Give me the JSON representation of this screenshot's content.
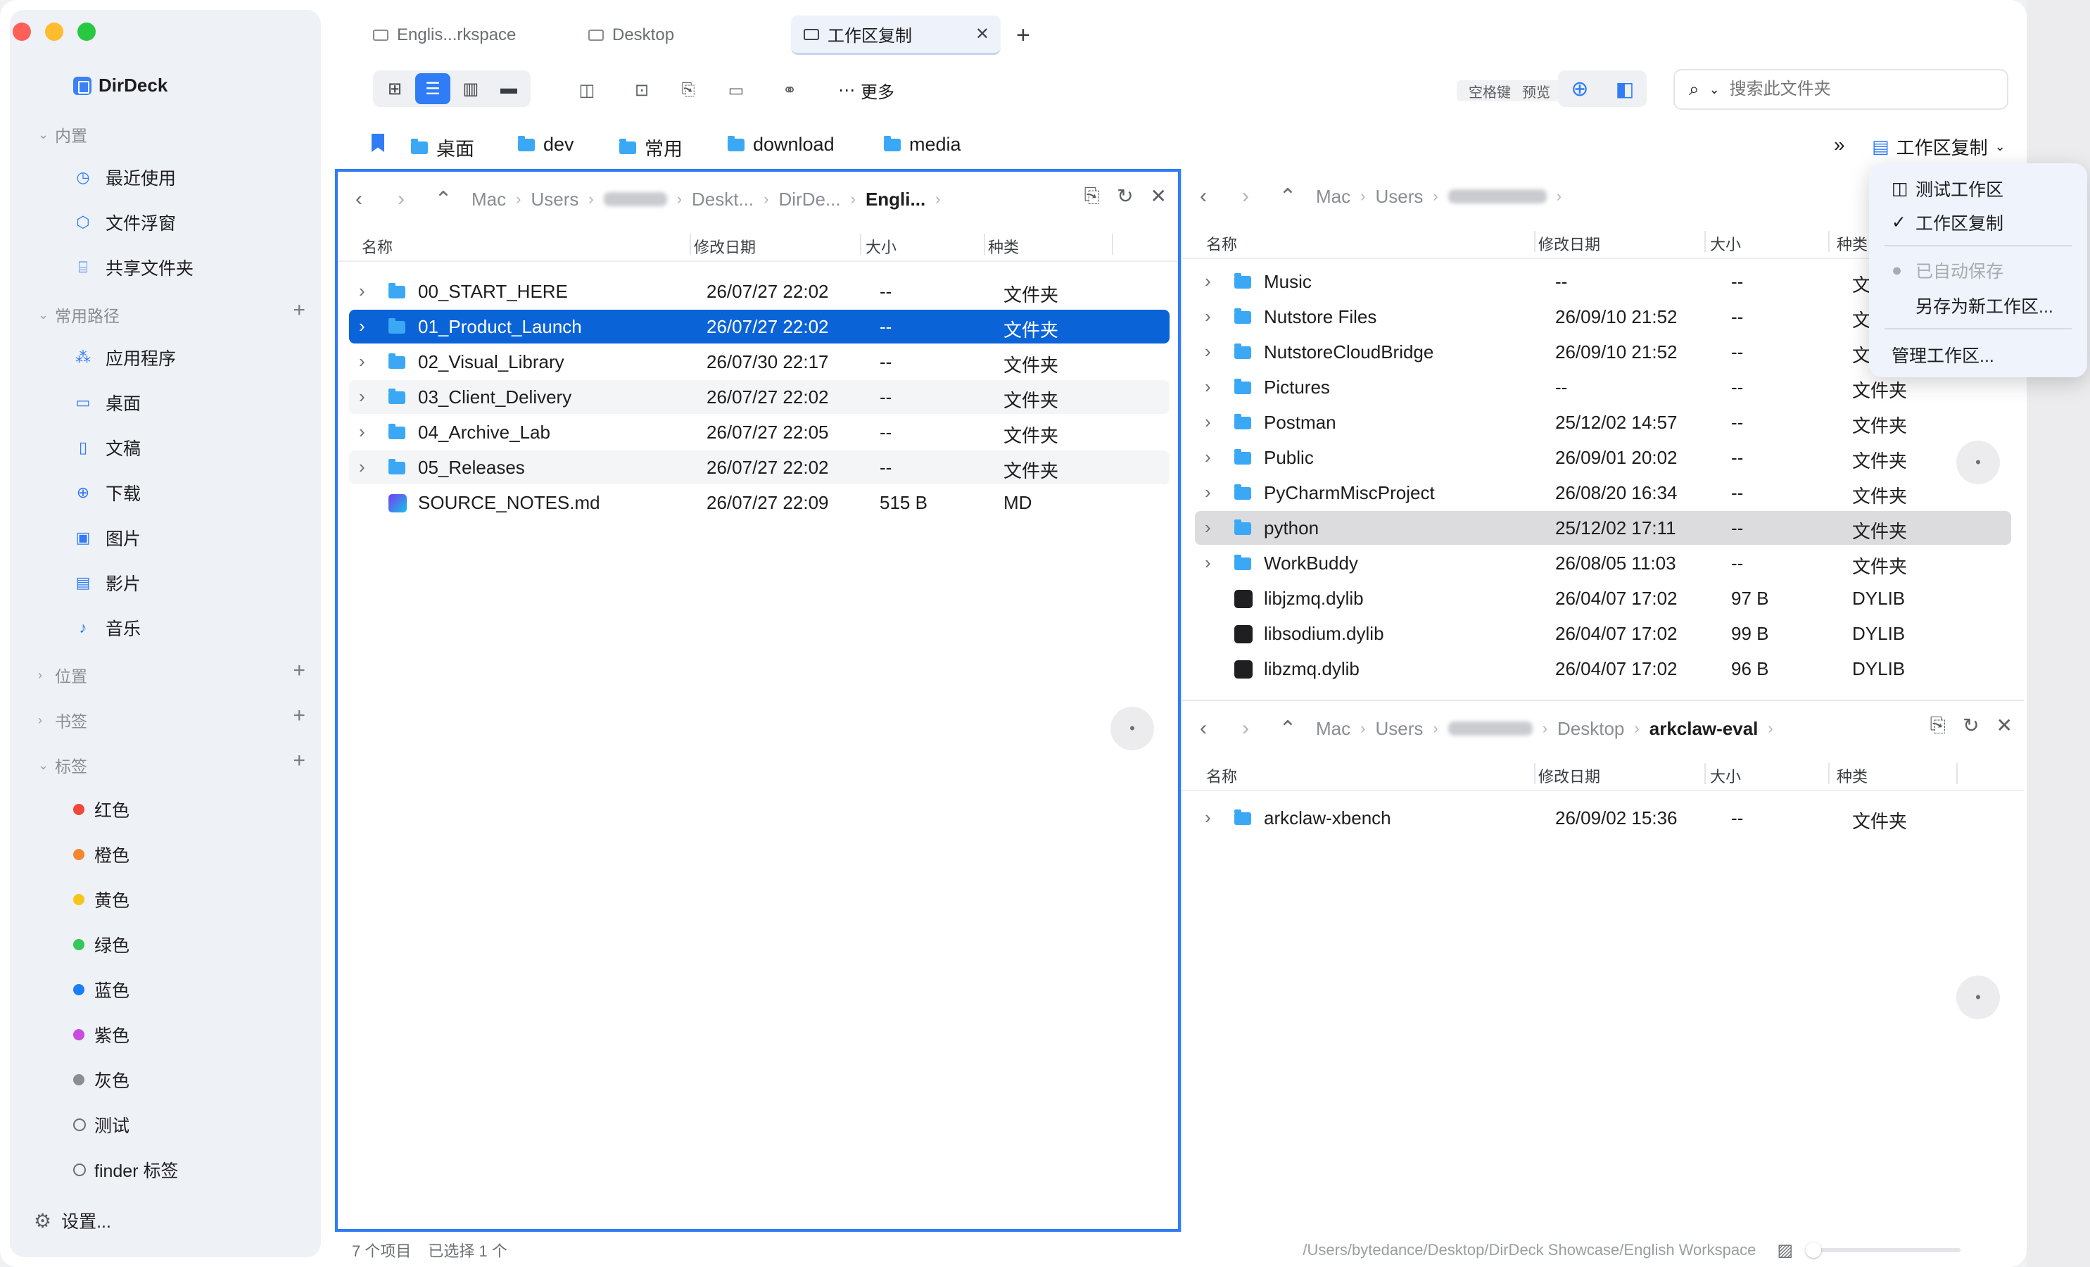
{
  "app": {
    "name": "DirDeck"
  },
  "sidebar": {
    "sections": {
      "builtin": "内置",
      "common": "常用路径",
      "locations": "位置",
      "bookmarks": "书签",
      "tags": "标签"
    },
    "builtin_items": [
      "最近使用",
      "文件浮窗",
      "共享文件夹"
    ],
    "common_items": [
      "应用程序",
      "桌面",
      "文稿",
      "下载",
      "图片",
      "影片",
      "音乐"
    ],
    "tags": [
      {
        "label": "红色",
        "color": "#f0473b"
      },
      {
        "label": "橙色",
        "color": "#f5862d"
      },
      {
        "label": "黄色",
        "color": "#f5c518"
      },
      {
        "label": "绿色",
        "color": "#34c759"
      },
      {
        "label": "蓝色",
        "color": "#1a7ef5"
      },
      {
        "label": "紫色",
        "color": "#c94be0"
      },
      {
        "label": "灰色",
        "color": "#8a8d93"
      },
      {
        "label": "测试",
        "color": ""
      },
      {
        "label": "finder 标签",
        "color": ""
      }
    ],
    "settings": "设置..."
  },
  "tabs": [
    {
      "label": "Englis...rkspace",
      "active": false
    },
    {
      "label": "Desktop",
      "active": false
    },
    {
      "label": "工作区复制",
      "active": true
    }
  ],
  "toolbar": {
    "more": "更多",
    "space_key": "空格键",
    "preview": "预览",
    "search_placeholder": "搜索此文件夹"
  },
  "bookmarks": [
    "桌面",
    "dev",
    "常用",
    "download",
    "media"
  ],
  "workspace_menu": {
    "current": "工作区复制",
    "items": [
      "测试工作区",
      "工作区复制"
    ],
    "auto_saved": "已自动保存",
    "save_as": "另存为新工作区...",
    "manage": "管理工作区..."
  },
  "columns": {
    "name": "名称",
    "modified": "修改日期",
    "size": "大小",
    "kind": "种类"
  },
  "left_pane": {
    "breadcrumb": [
      "Mac",
      "Users",
      "",
      "Deskt...",
      "DirDe...",
      "Engli..."
    ],
    "rows": [
      {
        "name": "00_START_HERE",
        "date": "26/07/27 22:02",
        "size": "--",
        "kind": "文件夹"
      },
      {
        "name": "01_Product_Launch",
        "date": "26/07/27 22:02",
        "size": "--",
        "kind": "文件夹"
      },
      {
        "name": "02_Visual_Library",
        "date": "26/07/30 22:17",
        "size": "--",
        "kind": "文件夹"
      },
      {
        "name": "03_Client_Delivery",
        "date": "26/07/27 22:02",
        "size": "--",
        "kind": "文件夹"
      },
      {
        "name": "04_Archive_Lab",
        "date": "26/07/27 22:05",
        "size": "--",
        "kind": "文件夹"
      },
      {
        "name": "05_Releases",
        "date": "26/07/27 22:02",
        "size": "--",
        "kind": "文件夹"
      },
      {
        "name": "SOURCE_NOTES.md",
        "date": "26/07/27 22:09",
        "size": "515 B",
        "kind": "MD"
      }
    ]
  },
  "right_top_pane": {
    "breadcrumb": [
      "Mac",
      "Users",
      ""
    ],
    "rows": [
      {
        "name": "Music",
        "date": "--",
        "size": "--",
        "kind": "文件夹"
      },
      {
        "name": "Nutstore Files",
        "date": "26/09/10 21:52",
        "size": "--",
        "kind": "文件夹"
      },
      {
        "name": "NutstoreCloudBridge",
        "date": "26/09/10 21:52",
        "size": "--",
        "kind": "文件夹"
      },
      {
        "name": "Pictures",
        "date": "--",
        "size": "--",
        "kind": "文件夹"
      },
      {
        "name": "Postman",
        "date": "25/12/02 14:57",
        "size": "--",
        "kind": "文件夹"
      },
      {
        "name": "Public",
        "date": "26/09/01 20:02",
        "size": "--",
        "kind": "文件夹"
      },
      {
        "name": "PyCharmMiscProject",
        "date": "26/08/20 16:34",
        "size": "--",
        "kind": "文件夹"
      },
      {
        "name": "python",
        "date": "25/12/02 17:11",
        "size": "--",
        "kind": "文件夹"
      },
      {
        "name": "WorkBuddy",
        "date": "26/08/05 11:03",
        "size": "--",
        "kind": "文件夹"
      },
      {
        "name": "libjzmq.dylib",
        "date": "26/04/07 17:02",
        "size": "97 B",
        "kind": "DYLIB"
      },
      {
        "name": "libsodium.dylib",
        "date": "26/04/07 17:02",
        "size": "99 B",
        "kind": "DYLIB"
      },
      {
        "name": "libzmq.dylib",
        "date": "26/04/07 17:02",
        "size": "96 B",
        "kind": "DYLIB"
      }
    ]
  },
  "right_bottom_pane": {
    "breadcrumb": [
      "Mac",
      "Users",
      "",
      "Desktop",
      "arkclaw-eval"
    ],
    "rows": [
      {
        "name": "arkclaw-xbench",
        "date": "26/09/02 15:36",
        "size": "--",
        "kind": "文件夹"
      }
    ]
  },
  "status": {
    "items": "7 个项目",
    "selected": "已选择 1 个",
    "path": "/Users/bytedance/Desktop/DirDeck Showcase/English Workspace"
  }
}
